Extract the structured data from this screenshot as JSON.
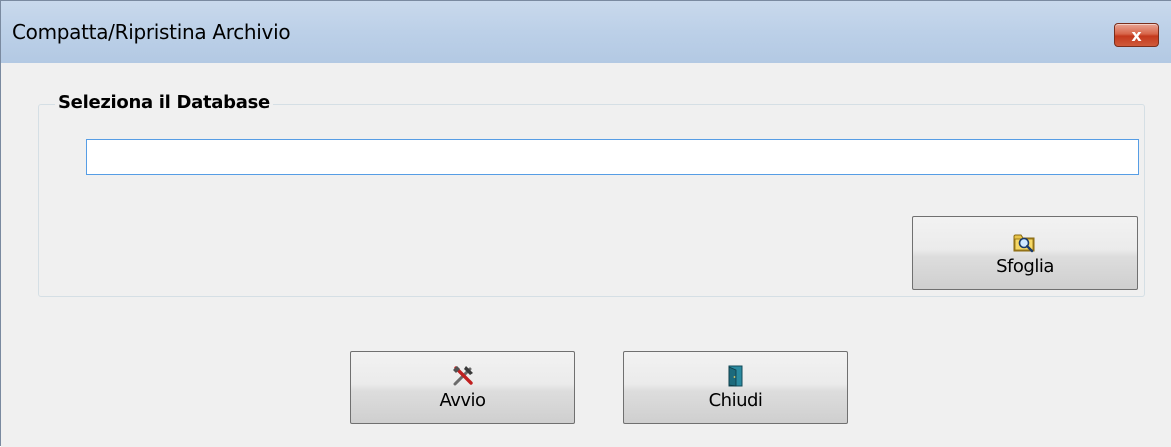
{
  "window": {
    "title": "Compatta/Ripristina Archivio",
    "close_glyph": "x"
  },
  "group": {
    "legend": "Seleziona il Database",
    "path_value": "",
    "path_placeholder": ""
  },
  "buttons": {
    "browse": {
      "label": "Sfoglia",
      "icon": "folder-search-icon"
    },
    "start": {
      "label": "Avvio",
      "icon": "tools-icon"
    },
    "close": {
      "label": "Chiudi",
      "icon": "door-icon"
    }
  },
  "colors": {
    "titlebar": "#bcd0e8",
    "close_button": "#c4391d",
    "input_border": "#569de5",
    "window_bg": "#f0f0f0"
  }
}
